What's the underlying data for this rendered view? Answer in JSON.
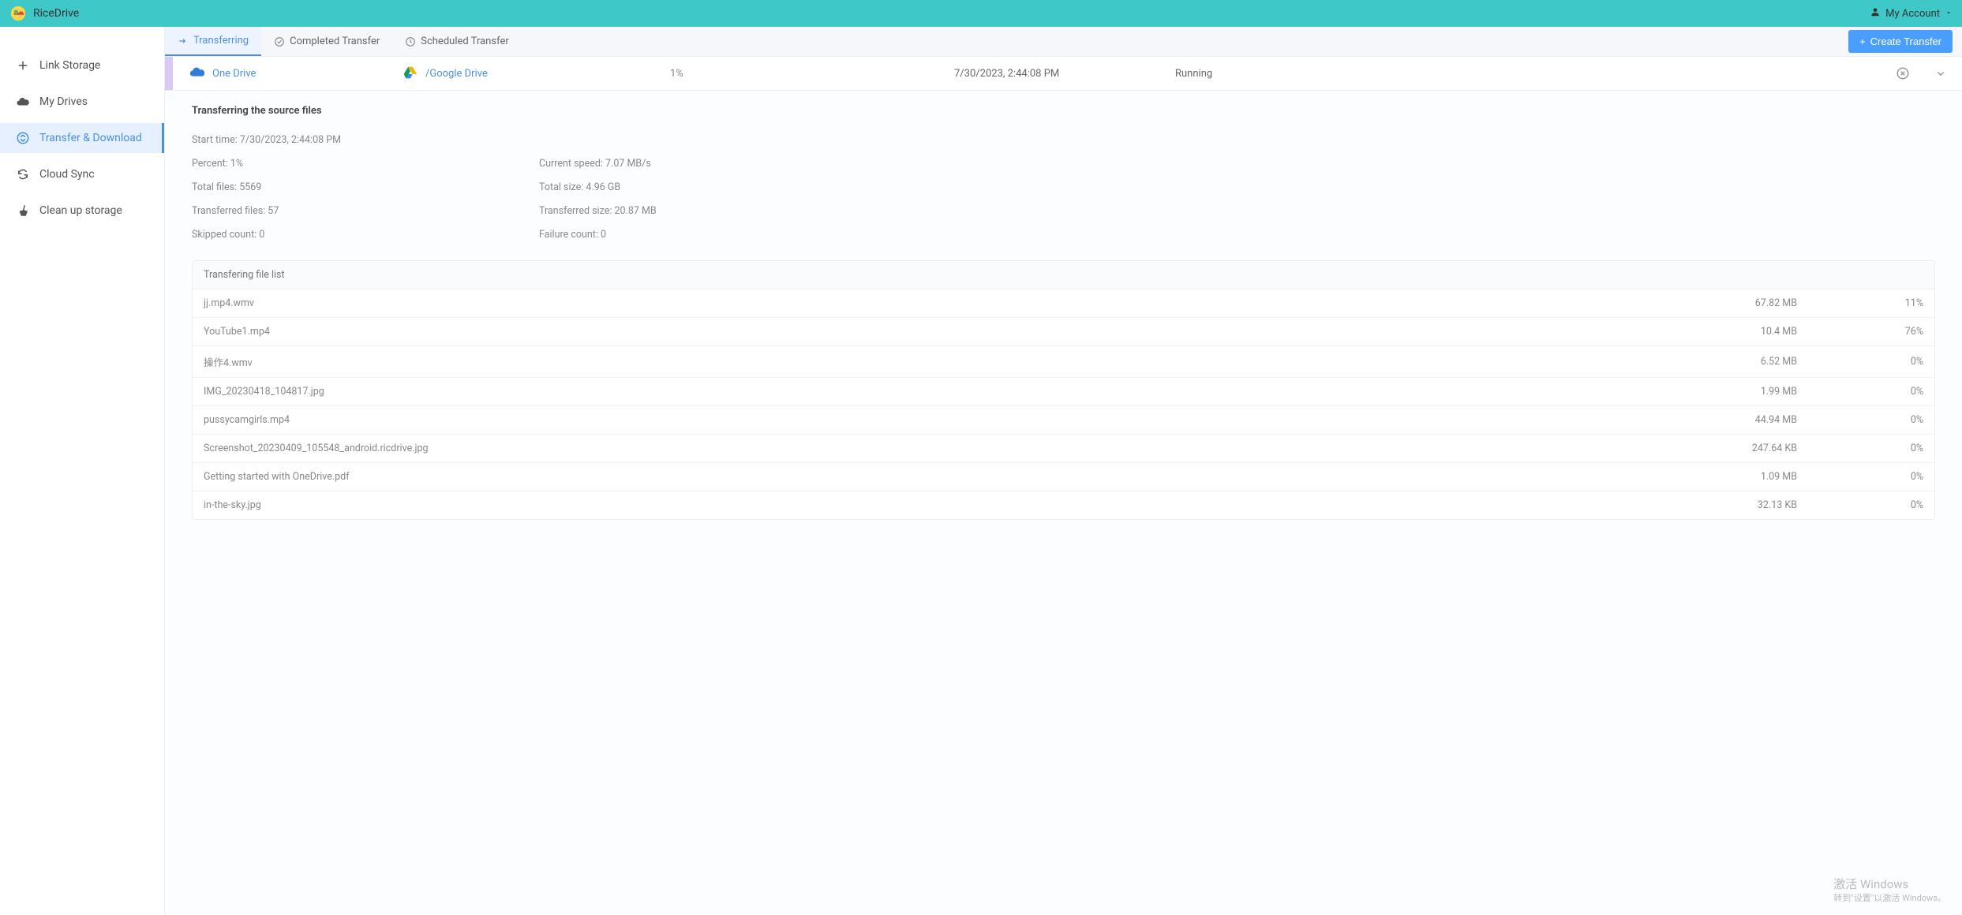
{
  "brand": "RiceDrive",
  "account": {
    "label": "My Account"
  },
  "sidebar": {
    "items": [
      {
        "label": "Link Storage"
      },
      {
        "label": "My Drives"
      },
      {
        "label": "Transfer & Download"
      },
      {
        "label": "Cloud Sync"
      },
      {
        "label": "Clean up storage"
      }
    ]
  },
  "tabs": {
    "transferring": "Transferring",
    "completed": "Completed Transfer",
    "scheduled": "Scheduled Transfer"
  },
  "create_button": "Create Transfer",
  "job": {
    "from": "One Drive",
    "to": "/Google Drive",
    "percent": "1%",
    "time": "7/30/2023, 2:44:08 PM",
    "status": "Running"
  },
  "details": {
    "title": "Transferring the source files",
    "start_time_label": "Start time: ",
    "start_time": "7/30/2023, 2:44:08 PM",
    "percent_label": "Percent: ",
    "percent": "1%",
    "total_files_label": "Total files: ",
    "total_files": "5569",
    "transferred_files_label": "Transferred files: ",
    "transferred_files": "57",
    "skipped_label": "Skipped count: ",
    "skipped": "0",
    "speed_label": "Current speed: ",
    "speed": "7.07 MB/s",
    "total_size_label": "Total size: ",
    "total_size": "4.96 GB",
    "transferred_size_label": "Transferred size: ",
    "transferred_size": "20.87 MB",
    "failure_label": "Failure count: ",
    "failure": "0"
  },
  "file_list": {
    "header": "Transfering file list",
    "rows": [
      {
        "name": "jj.mp4.wmv",
        "size": "67.82 MB",
        "prog": "11%"
      },
      {
        "name": "YouTube1.mp4",
        "size": "10.4 MB",
        "prog": "76%"
      },
      {
        "name": "操作4.wmv",
        "size": "6.52 MB",
        "prog": "0%"
      },
      {
        "name": "IMG_20230418_104817.jpg",
        "size": "1.99 MB",
        "prog": "0%"
      },
      {
        "name": "pussycamgirls.mp4",
        "size": "44.94 MB",
        "prog": "0%"
      },
      {
        "name": "Screenshot_20230409_105548_android.ricdrive.jpg",
        "size": "247.64 KB",
        "prog": "0%"
      },
      {
        "name": "Getting started with OneDrive.pdf",
        "size": "1.09 MB",
        "prog": "0%"
      },
      {
        "name": "in-the-sky.jpg",
        "size": "32.13 KB",
        "prog": "0%"
      }
    ]
  },
  "watermark": {
    "line1": "激活 Windows",
    "line2": "转到\"设置\"以激活 Windows。"
  }
}
